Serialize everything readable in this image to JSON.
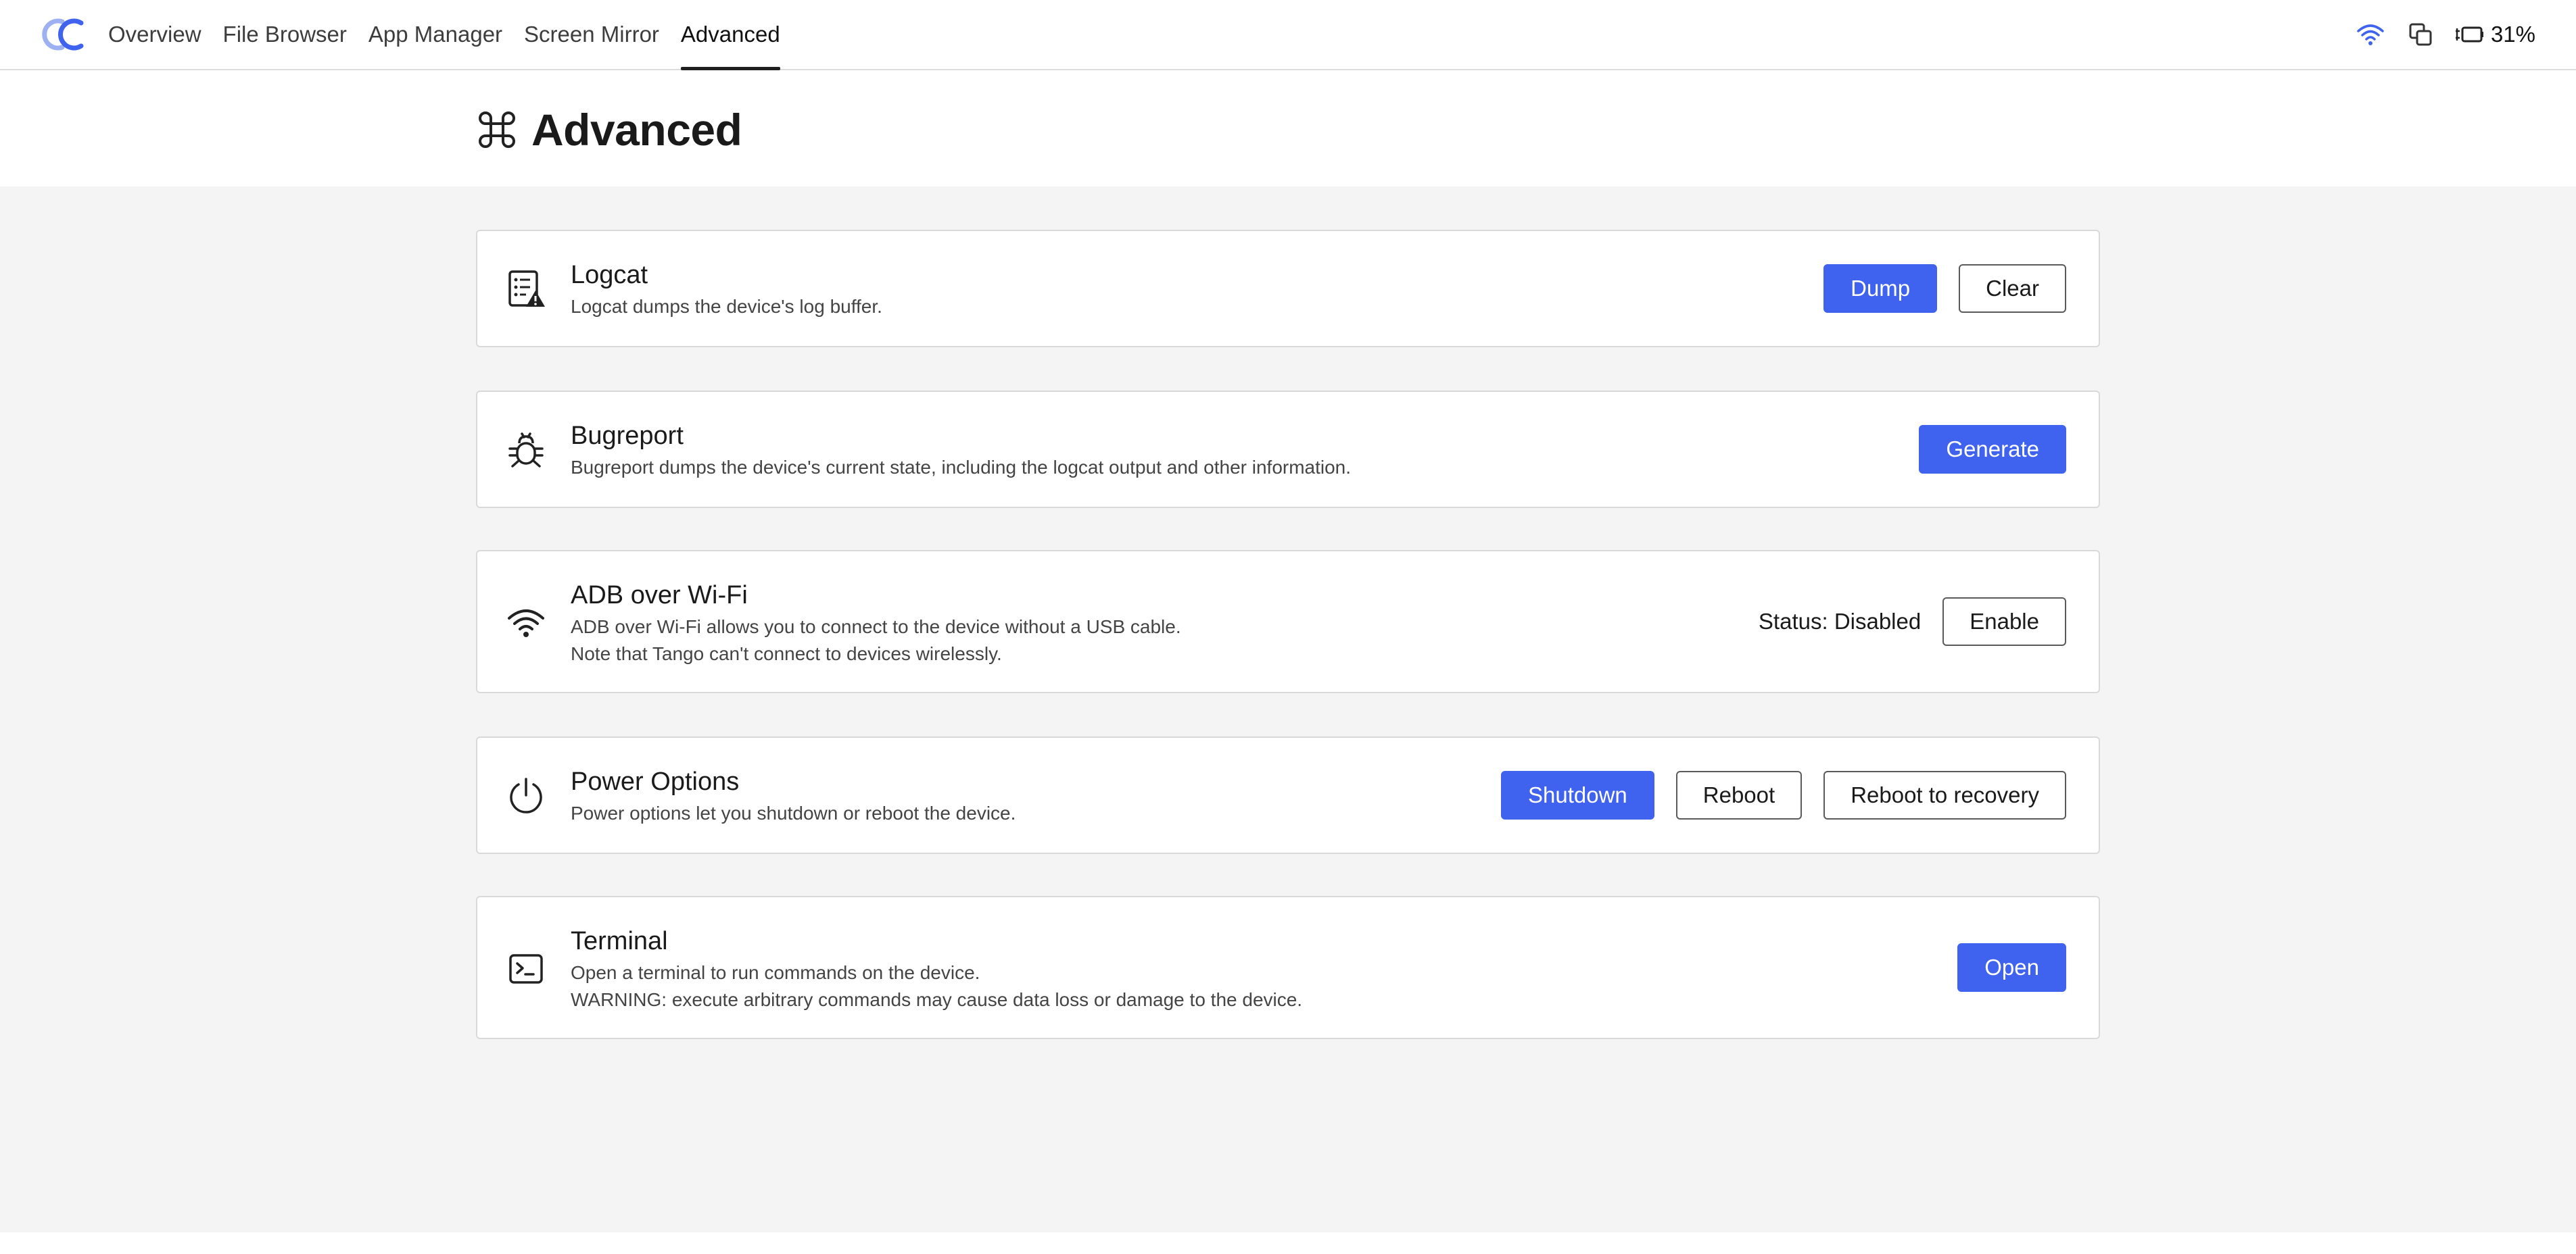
{
  "nav": {
    "tabs": [
      {
        "label": "Overview"
      },
      {
        "label": "File Browser"
      },
      {
        "label": "App Manager"
      },
      {
        "label": "Screen Mirror"
      },
      {
        "label": "Advanced"
      }
    ],
    "active_tab": "Advanced"
  },
  "status_bar": {
    "battery_percent": "31%",
    "icons": [
      "wifi-icon",
      "copy-icon",
      "battery-charging-icon"
    ]
  },
  "page": {
    "title": "Advanced",
    "title_icon": "command-icon"
  },
  "cards": {
    "logcat": {
      "icon": "log-warning-icon",
      "title": "Logcat",
      "description": "Logcat dumps the device's log buffer.",
      "buttons": {
        "dump": "Dump",
        "clear": "Clear"
      }
    },
    "bugreport": {
      "icon": "bug-icon",
      "title": "Bugreport",
      "description": "Bugreport dumps the device's current state, including the logcat output and other information.",
      "buttons": {
        "generate": "Generate"
      }
    },
    "adb_wifi": {
      "icon": "wifi-icon",
      "title": "ADB over Wi-Fi",
      "description_line1": "ADB over Wi-Fi allows you to connect to the device without a USB cable.",
      "description_line2": "Note that Tango can't connect to devices wirelessly.",
      "status": "Status: Disabled",
      "buttons": {
        "enable": "Enable"
      }
    },
    "power": {
      "icon": "power-icon",
      "title": "Power Options",
      "description": "Power options let you shutdown or reboot the device.",
      "buttons": {
        "shutdown": "Shutdown",
        "reboot": "Reboot",
        "reboot_recovery": "Reboot to recovery"
      }
    },
    "terminal": {
      "icon": "terminal-icon",
      "title": "Terminal",
      "description_line1": "Open a terminal to run commands on the device.",
      "description_line2": "WARNING: execute arbitrary commands may cause data loss or damage to the device.",
      "buttons": {
        "open": "Open"
      }
    }
  },
  "colors": {
    "accent": "#3f63ee",
    "content_bg": "#f4f4f4",
    "card_border": "#d9d9d9"
  }
}
